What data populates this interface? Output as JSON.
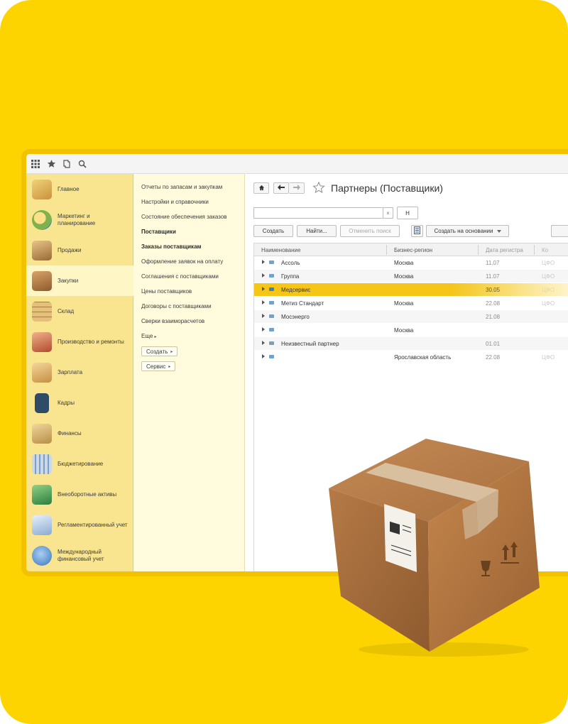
{
  "toolbar": {
    "icons": [
      "apps-grid-icon",
      "favorites-star-icon",
      "history-icon",
      "search-icon"
    ]
  },
  "sections": [
    {
      "label": "Главное",
      "icon": "home-section-icon",
      "color": "#e8b25a"
    },
    {
      "label": "Маркетинг и\nпланирование",
      "icon": "marketing-section-icon",
      "color": "#7fb24d"
    },
    {
      "label": "Продажи",
      "icon": "sales-section-icon",
      "color": "#c58a4a"
    },
    {
      "label": "Закупки",
      "icon": "purchases-section-icon",
      "color": "#b87a3c",
      "active": true
    },
    {
      "label": "Склад",
      "icon": "warehouse-section-icon",
      "color": "#caa05b"
    },
    {
      "label": "Производство и ремонты",
      "icon": "production-section-icon",
      "color": "#c65b3e"
    },
    {
      "label": "Зарплата",
      "icon": "salary-section-icon",
      "color": "#d8a65e"
    },
    {
      "label": "Кадры",
      "icon": "hr-section-icon",
      "color": "#2f4b66"
    },
    {
      "label": "Финансы",
      "icon": "finance-section-icon",
      "color": "#d9b36a"
    },
    {
      "label": "Бюджетирование",
      "icon": "budgeting-section-icon",
      "color": "#8aa8c8"
    },
    {
      "label": "Внеоборотные активы",
      "icon": "fixed-assets-section-icon",
      "color": "#3f9a52"
    },
    {
      "label": "Регламентированный учет",
      "icon": "regulated-accounting-section-icon",
      "color": "#9bb7d8"
    },
    {
      "label": "Международный\nфинансовый учет",
      "icon": "international-finance-section-icon",
      "color": "#4f86c8"
    }
  ],
  "functions": {
    "items": [
      {
        "label": "Отчеты по запасам и закупкам",
        "bold": false
      },
      {
        "label": "Настройки и справочники",
        "bold": false
      },
      {
        "label": "Состояние обеспечения заказов",
        "bold": false
      },
      {
        "label": "Поставщики",
        "bold": true
      },
      {
        "label": "Заказы поставщикам",
        "bold": true
      },
      {
        "label": "Оформление заявок на оплату",
        "bold": false
      },
      {
        "label": "Соглашения с поставщиками",
        "bold": false
      },
      {
        "label": "Цены поставщиков",
        "bold": false
      },
      {
        "label": "Договоры с поставщиками",
        "bold": false
      },
      {
        "label": "Сверки взаиморасчетов",
        "bold": false
      }
    ],
    "more_label": "Еще",
    "create_label": "Создать",
    "service_label": "Сервис"
  },
  "form": {
    "title": "Партнеры (Поставщики)",
    "search_placeholder": "",
    "clear_label": "×",
    "h_button": "Н",
    "buttons": {
      "create": "Создать",
      "find": "Найти...",
      "cancel_search": "Отменить поиск",
      "create_based_on": "Создать на основании"
    },
    "columns": [
      "Наименование",
      "Бизнес-регион",
      "Дата регистра",
      "Ко"
    ],
    "rows": [
      {
        "name": "Ассоль",
        "region": "Москва",
        "date": "11.07",
        "code": "ЦФО"
      },
      {
        "name": "Группа",
        "region": "Москва",
        "date": "11.07",
        "code": "ЦФО"
      },
      {
        "name": "Медсервис",
        "region": "",
        "date": "30.05",
        "code": "ЦФО",
        "selected": true
      },
      {
        "name": "Метиз Стандарт",
        "region": "Москва",
        "date": "22.08",
        "code": "ЦФО"
      },
      {
        "name": "Мосэнерго",
        "region": "",
        "date": "21.08",
        "code": ""
      },
      {
        "name": "",
        "region": "Москва",
        "date": "",
        "code": ""
      },
      {
        "name": "Неизвестный партнер",
        "region": "",
        "date": "01.01",
        "code": ""
      },
      {
        "name": "",
        "region": "Ярославская область",
        "date": "22.08",
        "code": "ЦФО"
      }
    ]
  },
  "colors": {
    "background": "#fdd400",
    "window_border": "#f2c200",
    "sections_panel": "#f9e58f",
    "functions_panel": "#fffbdc",
    "selected_row": "#f5c518"
  }
}
